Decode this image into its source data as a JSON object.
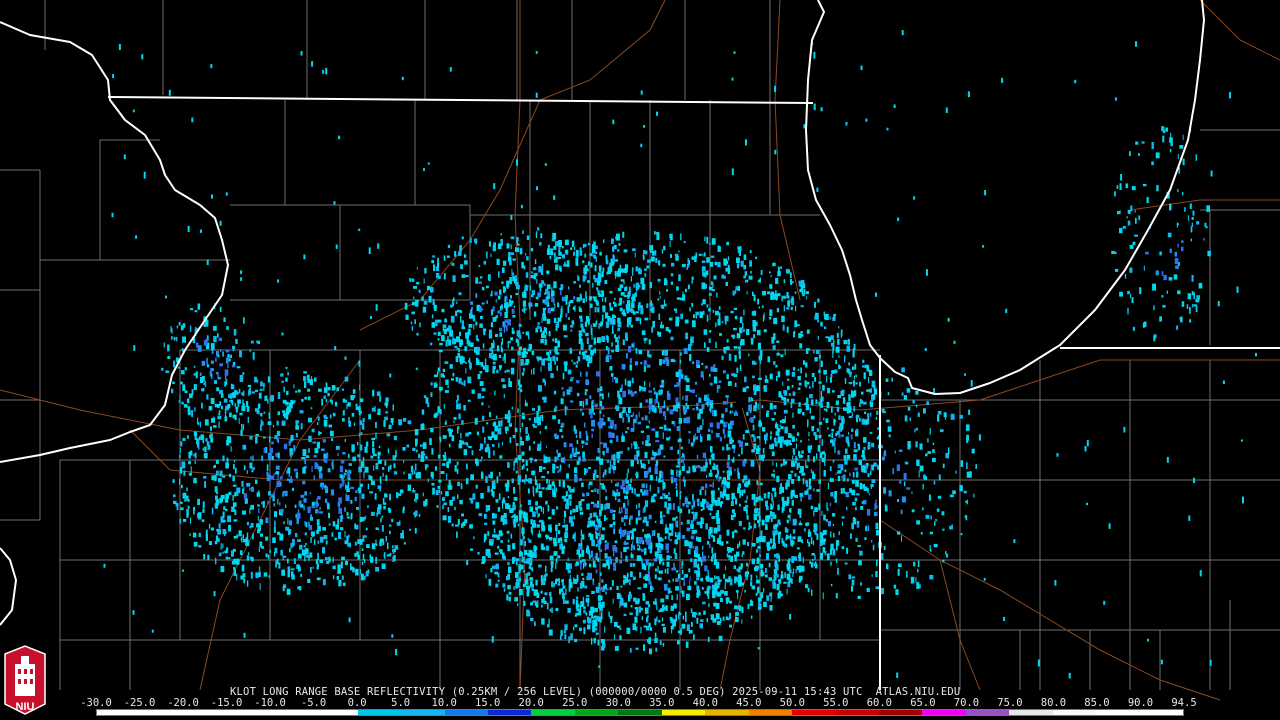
{
  "caption": "KLOT LONG RANGE BASE REFLECTIVITY (0.25KM / 256 LEVEL) (000000/0000 0.5 DEG) 2025-09-11 15:43 UTC  ATLAS.NIU.EDU",
  "logo": {
    "text": "NIU",
    "icon": "niu-tower-logo"
  },
  "scale": {
    "labels": [
      "-30.0",
      "-25.0",
      "-20.0",
      "-15.0",
      "-10.0",
      "-5.0",
      "0.0",
      "5.0",
      "10.0",
      "15.0",
      "20.0",
      "25.0",
      "30.0",
      "35.0",
      "40.0",
      "45.0",
      "50.0",
      "55.0",
      "60.0",
      "65.0",
      "70.0",
      "75.0",
      "80.0",
      "85.0",
      "90.0",
      "94.5"
    ],
    "colors": [
      "#ffffff",
      "#ffffff",
      "#ffffff",
      "#ffffff",
      "#ffffff",
      "#ffffff",
      "#00c8e8",
      "#18b4f0",
      "#1478e8",
      "#0c28d0",
      "#00d040",
      "#00a818",
      "#007810",
      "#f0f000",
      "#e8b400",
      "#f08000",
      "#e80000",
      "#c80000",
      "#a00000",
      "#f000f0",
      "#9850c8",
      "#e8e8e8",
      "#f8f8f8",
      "#ffffff",
      "#ffffff"
    ]
  },
  "radar": {
    "site": "KLOT",
    "echo_colors": [
      "#00d8f0",
      "#10b8f0",
      "#2090f0",
      "#3070e8"
    ]
  },
  "map": {
    "state_border_color": "#ffffff",
    "county_line_color": "#6e6e6e",
    "road_color": "#8a4a20"
  }
}
